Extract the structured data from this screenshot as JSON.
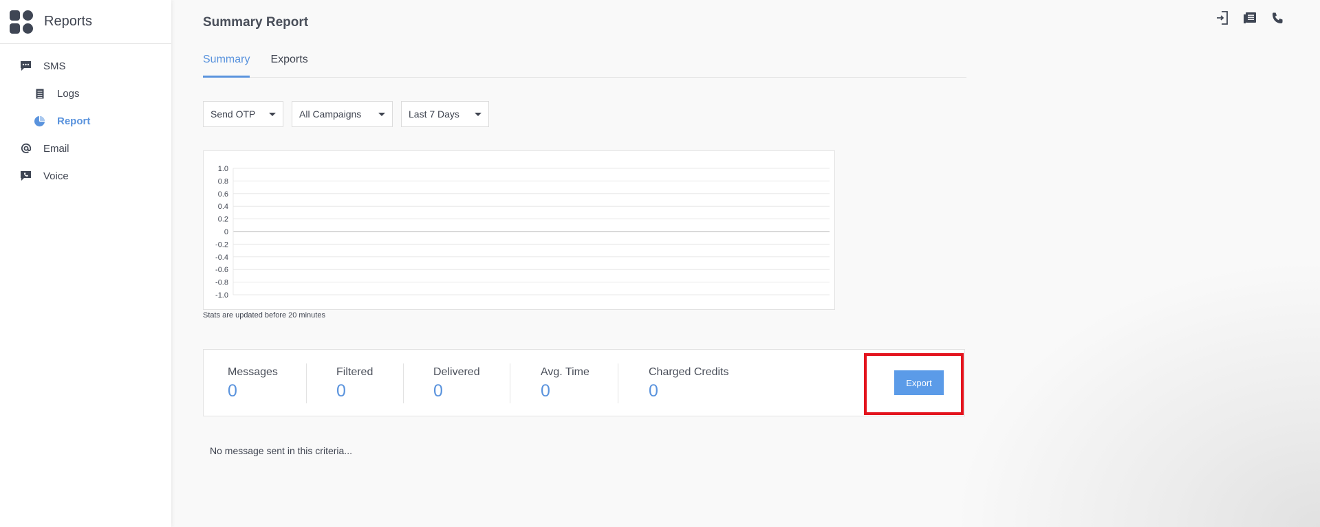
{
  "app": {
    "title": "Reports"
  },
  "sidebar": {
    "items": [
      {
        "label": "SMS",
        "icon": "message-bubble-icon",
        "level": 1,
        "active": false
      },
      {
        "label": "Logs",
        "icon": "list-document-icon",
        "level": 2,
        "active": false
      },
      {
        "label": "Report",
        "icon": "pie-chart-icon",
        "level": 2,
        "active": true
      },
      {
        "label": "Email",
        "icon": "at-sign-icon",
        "level": 1,
        "active": false
      },
      {
        "label": "Voice",
        "icon": "phone-chat-icon",
        "level": 1,
        "active": false
      }
    ]
  },
  "header_icons": [
    "logout-icon",
    "notes-icon",
    "phone-icon"
  ],
  "page": {
    "title": "Summary Report"
  },
  "tabs": [
    {
      "label": "Summary",
      "active": true
    },
    {
      "label": "Exports",
      "active": false
    }
  ],
  "filters": {
    "type": "Send OTP",
    "campaign": "All Campaigns",
    "period": "Last 7 Days"
  },
  "chart_data": {
    "type": "line",
    "series": [],
    "y_ticks": [
      "1.0",
      "0.8",
      "0.6",
      "0.4",
      "0.2",
      "0",
      "-0.2",
      "-0.4",
      "-0.6",
      "-0.8",
      "-1.0"
    ],
    "ylim": [
      -1.0,
      1.0
    ],
    "grid": true
  },
  "chart_note": "Stats are updated before 20 minutes",
  "stats": [
    {
      "label": "Messages",
      "value": "0"
    },
    {
      "label": "Filtered",
      "value": "0"
    },
    {
      "label": "Delivered",
      "value": "0"
    },
    {
      "label": "Avg. Time",
      "value": "0"
    },
    {
      "label": "Charged Credits",
      "value": "0"
    }
  ],
  "export_label": "Export",
  "empty_message": "No message sent in this criteria...",
  "colors": {
    "accent": "#5a93dd",
    "button": "#5b9be8",
    "highlight": "#e3141e",
    "text": "#3f4450"
  }
}
